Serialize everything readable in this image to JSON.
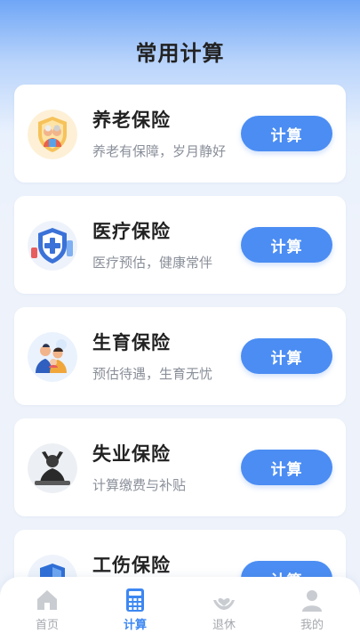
{
  "header": {
    "title": "常用计算"
  },
  "cards": [
    {
      "name": "养老保险",
      "subtitle": "养老有保障，岁月静好",
      "button": "计算",
      "icon": "elderly-couple-shield-icon"
    },
    {
      "name": "医疗保险",
      "subtitle": "医疗预估，健康常伴",
      "button": "计算",
      "icon": "medical-shield-cross-icon"
    },
    {
      "name": "生育保险",
      "subtitle": "预估待遇，生育无忧",
      "button": "计算",
      "icon": "family-baby-icon"
    },
    {
      "name": "失业保险",
      "subtitle": "计算缴费与补贴",
      "button": "计算",
      "icon": "worried-person-icon"
    },
    {
      "name": "工伤保险",
      "subtitle": "",
      "button": "计算",
      "icon": "injury-shield-icon"
    }
  ],
  "tabbar": {
    "items": [
      {
        "label": "首页",
        "icon": "home-icon"
      },
      {
        "label": "计算",
        "icon": "calculator-icon"
      },
      {
        "label": "退休",
        "icon": "heart-hands-icon"
      },
      {
        "label": "我的",
        "icon": "user-icon"
      }
    ],
    "active": "计算"
  },
  "colors": {
    "accent": "#4b8df3",
    "active_tab": "#3d87f2",
    "inactive_tab": "#c9ccd1"
  }
}
